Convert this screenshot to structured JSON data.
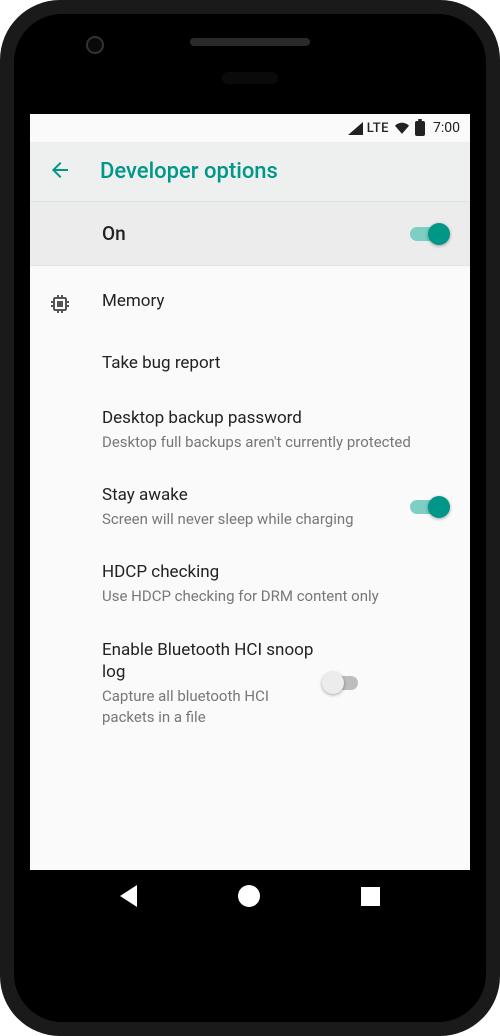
{
  "status": {
    "network": "LTE",
    "time": "7:00"
  },
  "appbar": {
    "title": "Developer options"
  },
  "master": {
    "label": "On"
  },
  "rows": {
    "memory": {
      "title": "Memory"
    },
    "bugreport": {
      "title": "Take bug report"
    },
    "backup": {
      "title": "Desktop backup password",
      "subtitle": "Desktop full backups aren't currently protected"
    },
    "stayawake": {
      "title": "Stay awake",
      "subtitle": "Screen will never sleep while charging"
    },
    "hdcp": {
      "title": "HDCP checking",
      "subtitle": "Use HDCP checking for DRM content only"
    },
    "btsnoop": {
      "title": "Enable Bluetooth HCI snoop log",
      "subtitle": "Capture all bluetooth HCI packets in a file"
    }
  }
}
